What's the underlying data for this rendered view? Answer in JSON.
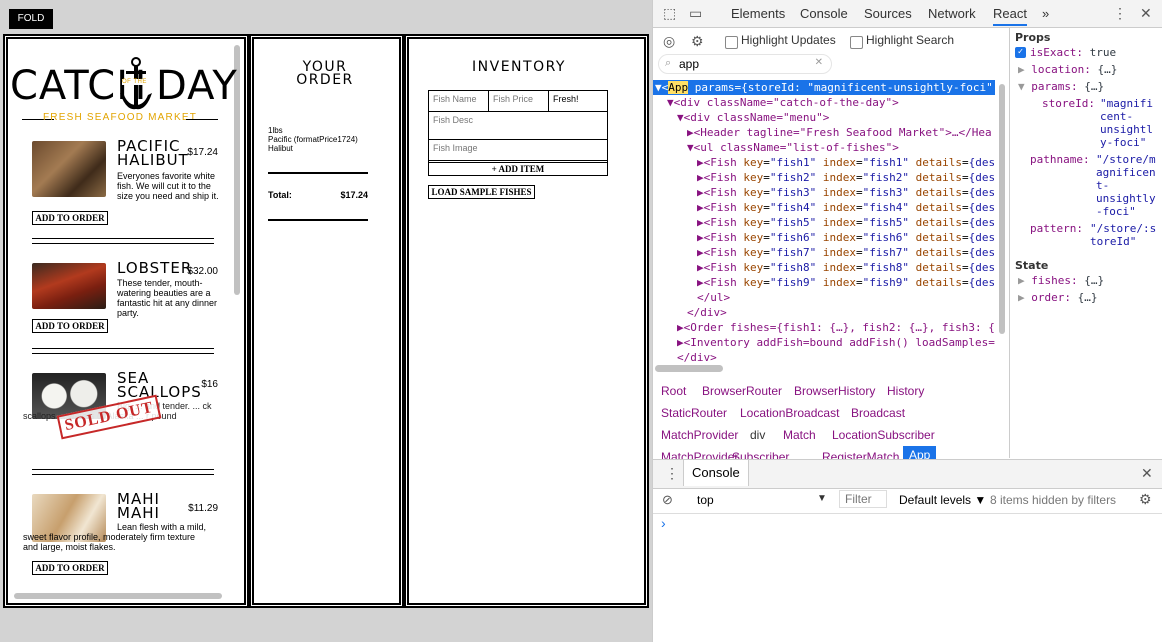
{
  "fold_button": "FOLD",
  "logo": {
    "left_word": "CATCH",
    "mid_word": "OF THE",
    "right_word": "DAY",
    "tagline": "FRESH SEAFOOD MARKET"
  },
  "menu": {
    "fishes": [
      {
        "name_line1": "PACIFIC",
        "name_line2": "HALIBUT",
        "price": "$17.24",
        "desc": "Everyones favorite white fish. We will cut it to the size you need and ship it.",
        "button": "ADD TO ORDER"
      },
      {
        "name_line1": "LOBSTER",
        "name_line2": "",
        "price": "$32.00",
        "desc": "These tender, mouth-watering beauties are a fantastic hit at any dinner party.",
        "button": "ADD TO ORDER"
      },
      {
        "name_line1": "SEA",
        "name_line2": "SCALLOPS",
        "price": "$16",
        "desc": "Big, ... and tender. ... ck scallops ... waters of Alaska ... r pound",
        "button": ""
      },
      {
        "name_line1": "MAHI",
        "name_line2": "MAHI",
        "price": "$11.29",
        "desc": "Lean flesh with a mild, sweet flavor profile, moderately firm texture and large, moist flakes.",
        "button": "ADD TO ORDER"
      }
    ],
    "sold_out": "SOLD OUT"
  },
  "order": {
    "title_line1": "YOUR",
    "title_line2": "ORDER",
    "item_line1": "1lbs",
    "item_line2": "Pacific (formatPrice1724)",
    "item_line3": "Halibut",
    "total_label": "Total:",
    "total_value": "$17.24"
  },
  "inventory": {
    "title": "INVENTORY",
    "fish_name_placeholder": "Fish Name",
    "fish_price_placeholder": "Fish Price",
    "status_value": "Fresh!",
    "fish_desc_placeholder": "Fish Desc",
    "fish_image_placeholder": "Fish Image",
    "add_button": "+ ADD ITEM",
    "load_button": "LOAD SAMPLE FISHES"
  },
  "devtools": {
    "tabs": [
      "Elements",
      "Console",
      "Sources",
      "Network",
      "React"
    ],
    "active_tab": "React",
    "more": "»",
    "highlight_updates": "Highlight Updates",
    "highlight_search": "Highlight Search",
    "search_value": "app",
    "tree": {
      "app_tag": "App",
      "app_attr": "params",
      "app_val": "={storeId: \"magnificent-unsightly-foci\"",
      "div1": "<div className=\"catch-of-the-day\">",
      "div2": "<div className=\"menu\">",
      "header": "<Header tagline=\"Fresh Seafood Market\">…</Hea",
      "ul": "<ul className=\"list-of-fishes\">",
      "fish_keys": [
        "fish1",
        "fish2",
        "fish3",
        "fish4",
        "fish5",
        "fish6",
        "fish7",
        "fish8",
        "fish9"
      ],
      "ul_close": "</ul>",
      "div_close": "</div>",
      "order_line": "<Order fishes={fish1: {…}, fish2: {…}, fish3: {",
      "inventory_line": "<Inventory addFish=bound addFish() loadSamples=",
      "div_close2": "</div>"
    },
    "breadcrumbs": [
      "Root",
      "BrowserRouter",
      "BrowserHistory",
      "History",
      "StaticRouter",
      "LocationBroadcast",
      "Broadcast",
      "MatchProvider",
      "div",
      "Match",
      "LocationSubscriber",
      "MatchProvider",
      "Subscriber",
      "RegisterMatch",
      "App"
    ],
    "props": {
      "header": "Props",
      "isExact_key": "isExact:",
      "isExact_val": "true",
      "location_key": "location:",
      "location_val": "{…}",
      "params_key": "params:",
      "params_val": "{…}",
      "storeId_key": "storeId:",
      "storeId_val_lines": [
        "\"magnifi",
        "cent-",
        "unsightl",
        "y-foci\""
      ],
      "pathname_key": "pathname:",
      "pathname_val_lines": [
        "\"/store/m",
        "agnificen",
        "t-",
        "unsightly",
        "-foci\""
      ],
      "pattern_key": "pattern:",
      "pattern_val_lines": [
        "\"/store/:s",
        "toreId\""
      ],
      "state_header": "State",
      "fishes_key": "fishes:",
      "fishes_val": "{…}",
      "order_key": "order:",
      "order_val": "{…}"
    },
    "console": {
      "title": "Console",
      "context": "top",
      "filter_placeholder": "Filter",
      "levels": "Default levels ▼",
      "hidden": "8 items hidden by filters",
      "prompt": "›"
    }
  }
}
